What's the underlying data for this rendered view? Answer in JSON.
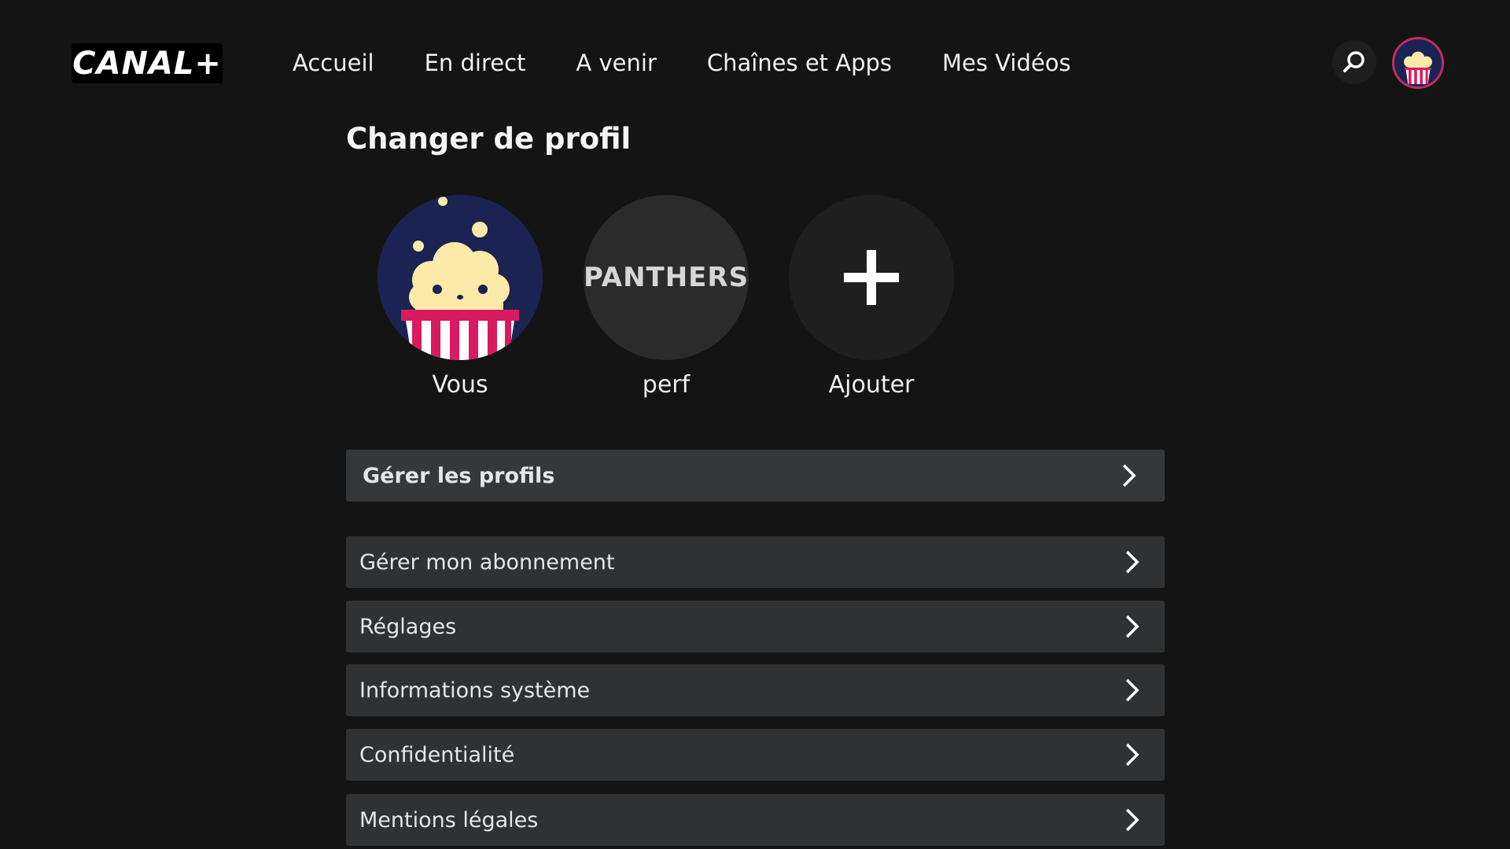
{
  "header": {
    "logo_text": "CANAL+",
    "nav": [
      {
        "label": "Accueil"
      },
      {
        "label": "En direct"
      },
      {
        "label": "A venir"
      },
      {
        "label": "Chaînes et Apps"
      },
      {
        "label": "Mes Vidéos"
      }
    ],
    "search_icon": "search-icon",
    "avatar_icon": "popcorn-avatar-icon"
  },
  "page": {
    "title": "Changer de profil"
  },
  "profiles": [
    {
      "name": "Vous",
      "avatar": "popcorn-avatar-icon"
    },
    {
      "name": "perf",
      "avatar_text": "PANTHERS"
    },
    {
      "name": "Ajouter",
      "avatar": "plus-icon"
    }
  ],
  "menu": [
    {
      "label": "Gérer les profils"
    },
    {
      "label": "Gérer mon abonnement"
    },
    {
      "label": "Réglages"
    },
    {
      "label": "Informations système"
    },
    {
      "label": "Confidentialité"
    },
    {
      "label": "Mentions légales"
    }
  ],
  "colors": {
    "background": "#141414",
    "row": "#2f3133",
    "avatar_bg": "#1b2352",
    "popcorn_stripe": "#d81b60",
    "popcorn_kernel": "#fbeaa8"
  }
}
